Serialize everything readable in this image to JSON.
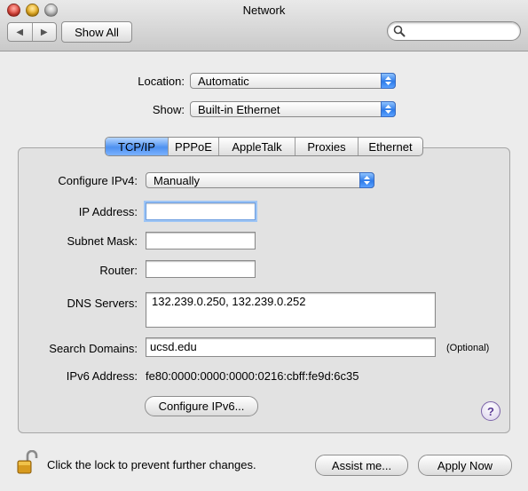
{
  "window": {
    "title": "Network"
  },
  "toolbar": {
    "back_glyph": "◀",
    "forward_glyph": "▶",
    "show_all_label": "Show All",
    "search_placeholder": ""
  },
  "location": {
    "label": "Location:",
    "value": "Automatic"
  },
  "show": {
    "label": "Show:",
    "value": "Built-in Ethernet"
  },
  "tabs": [
    {
      "label": "TCP/IP",
      "active": true
    },
    {
      "label": "PPPoE",
      "active": false
    },
    {
      "label": "AppleTalk",
      "active": false
    },
    {
      "label": "Proxies",
      "active": false
    },
    {
      "label": "Ethernet",
      "active": false
    }
  ],
  "tcpip": {
    "configure_label": "Configure IPv4:",
    "configure_value": "Manually",
    "ip_label": "IP Address:",
    "ip_value": "",
    "subnet_label": "Subnet Mask:",
    "subnet_value": "",
    "router_label": "Router:",
    "router_value": "",
    "dns_label": "DNS Servers:",
    "dns_value": "132.239.0.250, 132.239.0.252",
    "search_domains_label": "Search Domains:",
    "search_domains_value": "ucsd.edu",
    "optional_label": "(Optional)",
    "ipv6_label": "IPv6 Address:",
    "ipv6_value": "fe80:0000:0000:0000:0216:cbff:fe9d:6c35",
    "configure_ipv6_label": "Configure IPv6...",
    "help_glyph": "?"
  },
  "footer": {
    "lock_text": "Click the lock to prevent further changes.",
    "assist_label": "Assist me...",
    "apply_label": "Apply Now"
  },
  "colors": {
    "accent": "#2f7be8",
    "window_bg": "#ececec"
  }
}
